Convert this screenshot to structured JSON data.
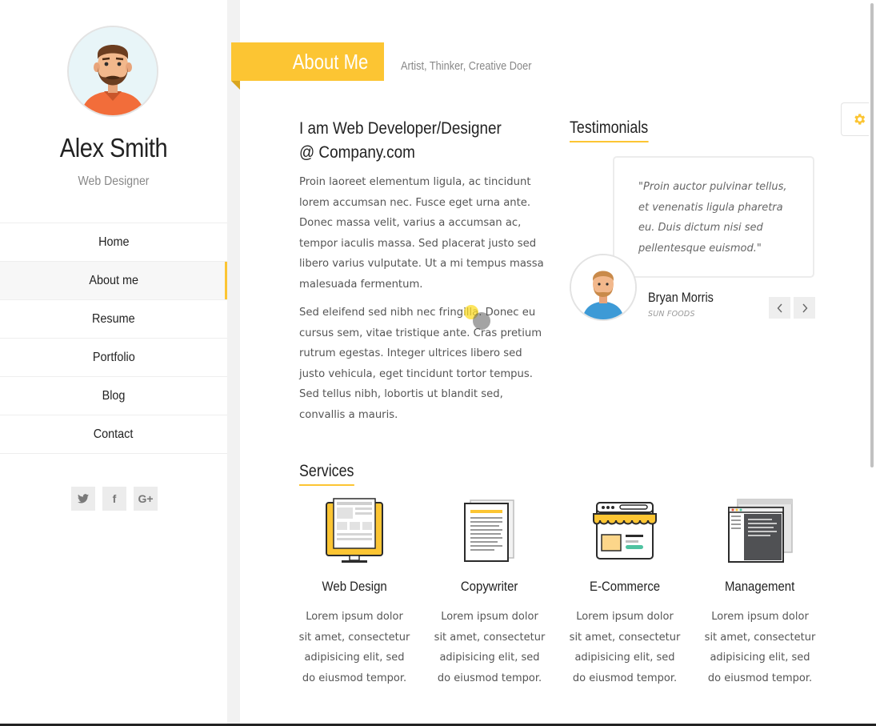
{
  "profile": {
    "name": "Alex Smith",
    "role": "Web Designer"
  },
  "nav": {
    "items": [
      {
        "label": "Home",
        "active": false
      },
      {
        "label": "About me",
        "active": true
      },
      {
        "label": "Resume",
        "active": false
      },
      {
        "label": "Portfolio",
        "active": false
      },
      {
        "label": "Blog",
        "active": false
      },
      {
        "label": "Contact",
        "active": false
      }
    ]
  },
  "social": {
    "twitter": "twitter-icon",
    "facebook": "facebook-icon",
    "googleplus": "google-plus-icon",
    "facebook_glyph": "f",
    "googleplus_glyph": "G+"
  },
  "section": {
    "title": "About Me",
    "tagline": "Artist, Thinker, Creative Doer"
  },
  "intro": {
    "heading": "I am Web Developer/Designer @ Company.com",
    "paragraph_1": "Proin laoreet elementum ligula, ac tincidunt lorem accumsan nec. Fusce eget urna ante. Donec massa velit, varius a accumsan ac, tempor iaculis massa. Sed placerat justo sed libero varius vulputate. Ut a mi tempus massa malesuada fermentum.",
    "paragraph_2": "Sed eleifend sed nibh nec fringilla. Donec eu cursus sem, vitae tristique ante. Cras pretium rutrum egestas. Integer ultrices libero sed justo vehicula, eget tincidunt tortor tempus. Sed tellus nibh, lobortis ut blandit sed, convallis a mauris."
  },
  "testimonials": {
    "title": "Testimonials",
    "quote": "\"Proin auctor pulvinar tellus, et venenatis ligula pharetra eu. Duis dictum nisi sed pellentesque euismod.\"",
    "client_name": "Bryan Morris",
    "client_company": "SUN FOODS"
  },
  "services": {
    "title": "Services",
    "items": [
      {
        "title": "Web Design",
        "description": "Lorem ipsum dolor sit amet, consectetur adipisicing elit, sed do eiusmod tempor.",
        "icon": "monitor-icon"
      },
      {
        "title": "Copywriter",
        "description": "Lorem ipsum dolor sit amet, consectetur adipisicing elit, sed do eiusmod tempor.",
        "icon": "document-icon"
      },
      {
        "title": "E-Commerce",
        "description": "Lorem ipsum dolor sit amet, consectetur adipisicing elit, sed do eiusmod tempor.",
        "icon": "storefront-icon"
      },
      {
        "title": "Management",
        "description": "Lorem ipsum dolor sit amet, consectetur adipisicing elit, sed do eiusmod tempor.",
        "icon": "windows-icon"
      }
    ]
  },
  "colors": {
    "accent": "#fcc533",
    "text": "#222222",
    "muted": "#888888"
  }
}
